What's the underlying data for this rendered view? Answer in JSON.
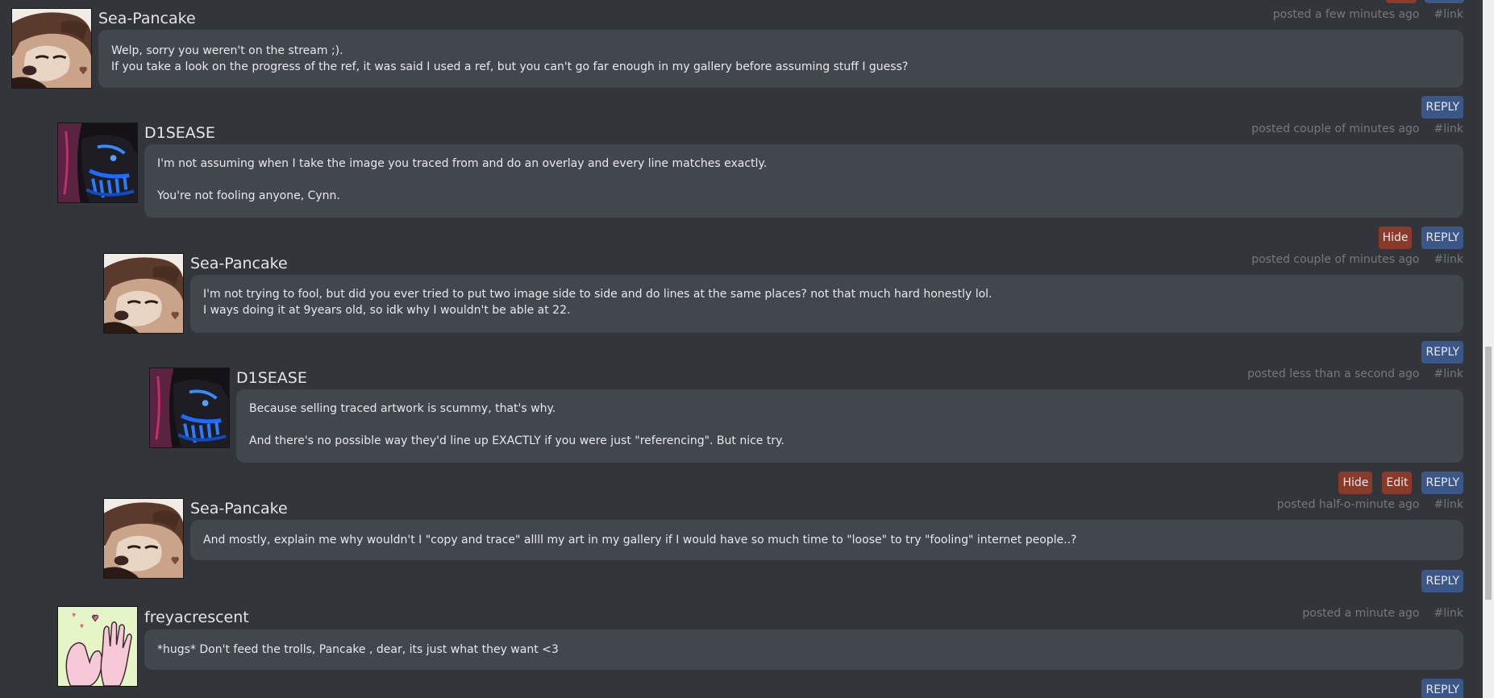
{
  "colors": {
    "page_bg": "#32353a",
    "bubble_bg": "#42464d",
    "reply_btn": "#3b5787",
    "hide_btn": "#8a3a2b",
    "meta_text": "#74787f"
  },
  "comments": [
    {
      "username": "Sea-Pancake",
      "avatar": "sea-pancake-avatar",
      "time": "posted a few minutes ago",
      "link": "#link",
      "lines": [
        "Welp, sorry you weren't on the stream ;).",
        "If you take a look on the progress of the ref, it was said I used a ref, but you can't go far enough in my gallery before assuming stuff I guess?"
      ],
      "actions": {
        "reply": "REPLY"
      }
    },
    {
      "username": "D1SEASE",
      "avatar": "d1sease-avatar",
      "time": "posted couple of minutes ago",
      "link": "#link",
      "lines": [
        "I'm not assuming when I take the image you traced from and do an overlay and every line matches exactly.",
        "",
        "You're not fooling anyone, Cynn."
      ],
      "actions": {
        "hide": "Hide",
        "reply": "REPLY"
      }
    },
    {
      "username": "Sea-Pancake",
      "avatar": "sea-pancake-avatar",
      "time": "posted couple of minutes ago",
      "link": "#link",
      "lines": [
        "I'm not trying to fool, but did you ever tried to put two image side to side and do lines at the same places? not that much hard honestly lol.",
        "I ways doing it at 9years old, so idk why I wouldn't be able at 22."
      ],
      "actions": {
        "reply": "REPLY"
      }
    },
    {
      "username": "D1SEASE",
      "avatar": "d1sease-avatar",
      "time": "posted less than a second ago",
      "link": "#link",
      "lines": [
        "Because selling traced artwork is scummy, that's why.",
        "",
        "And there's no possible way they'd line up EXACTLY if you were just \"referencing\". But nice try."
      ],
      "actions": {
        "hide": "Hide",
        "edit": "Edit",
        "reply": "REPLY"
      }
    },
    {
      "username": "Sea-Pancake",
      "avatar": "sea-pancake-avatar",
      "time": "posted half-o-minute ago",
      "link": "#link",
      "lines": [
        "And mostly, explain me why wouldn't I \"copy and trace\" allll my art in my gallery if I would have so much time to \"loose\" to try \"fooling\" internet people..?"
      ],
      "actions": {
        "reply": "REPLY"
      }
    },
    {
      "username": "freyacrescent",
      "avatar": "freyacrescent-avatar",
      "time": "posted a minute ago",
      "link": "#link",
      "lines": [
        "*hugs* Don't feed the trolls, Pancake , dear, its just what they want <3"
      ],
      "actions": {
        "reply": "REPLY"
      }
    }
  ]
}
